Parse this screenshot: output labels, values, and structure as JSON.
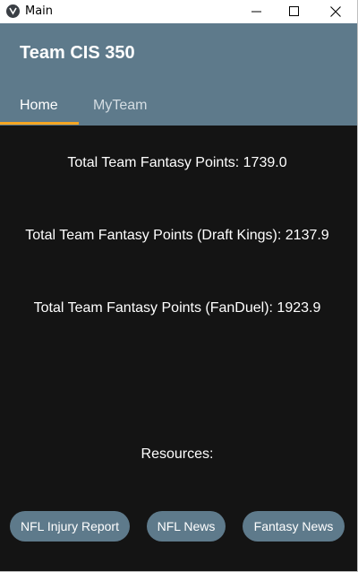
{
  "window": {
    "title": "Main",
    "controls": {
      "minimize": "minimize-icon",
      "maximize": "maximize-icon",
      "close": "close-icon"
    }
  },
  "header": {
    "title": "Team CIS 350",
    "tabs": [
      {
        "label": "Home",
        "active": true
      },
      {
        "label": "MyTeam",
        "active": false
      }
    ]
  },
  "main": {
    "stats": [
      {
        "label": "Total Team Fantasy Points: 1739.0"
      },
      {
        "label": "Total Team Fantasy Points (Draft Kings): 2137.9"
      },
      {
        "label": "Total Team Fantasy Points (FanDuel): 1923.9"
      }
    ],
    "resources_label": "Resources:",
    "resource_buttons": [
      {
        "label": "NFL Injury Report"
      },
      {
        "label": "NFL News"
      },
      {
        "label": "Fantasy News"
      }
    ]
  },
  "colors": {
    "header_bg": "#5e7a8b",
    "content_bg": "#141414",
    "tab_indicator": "#f5a623",
    "button_bg": "#5e7a8b"
  }
}
